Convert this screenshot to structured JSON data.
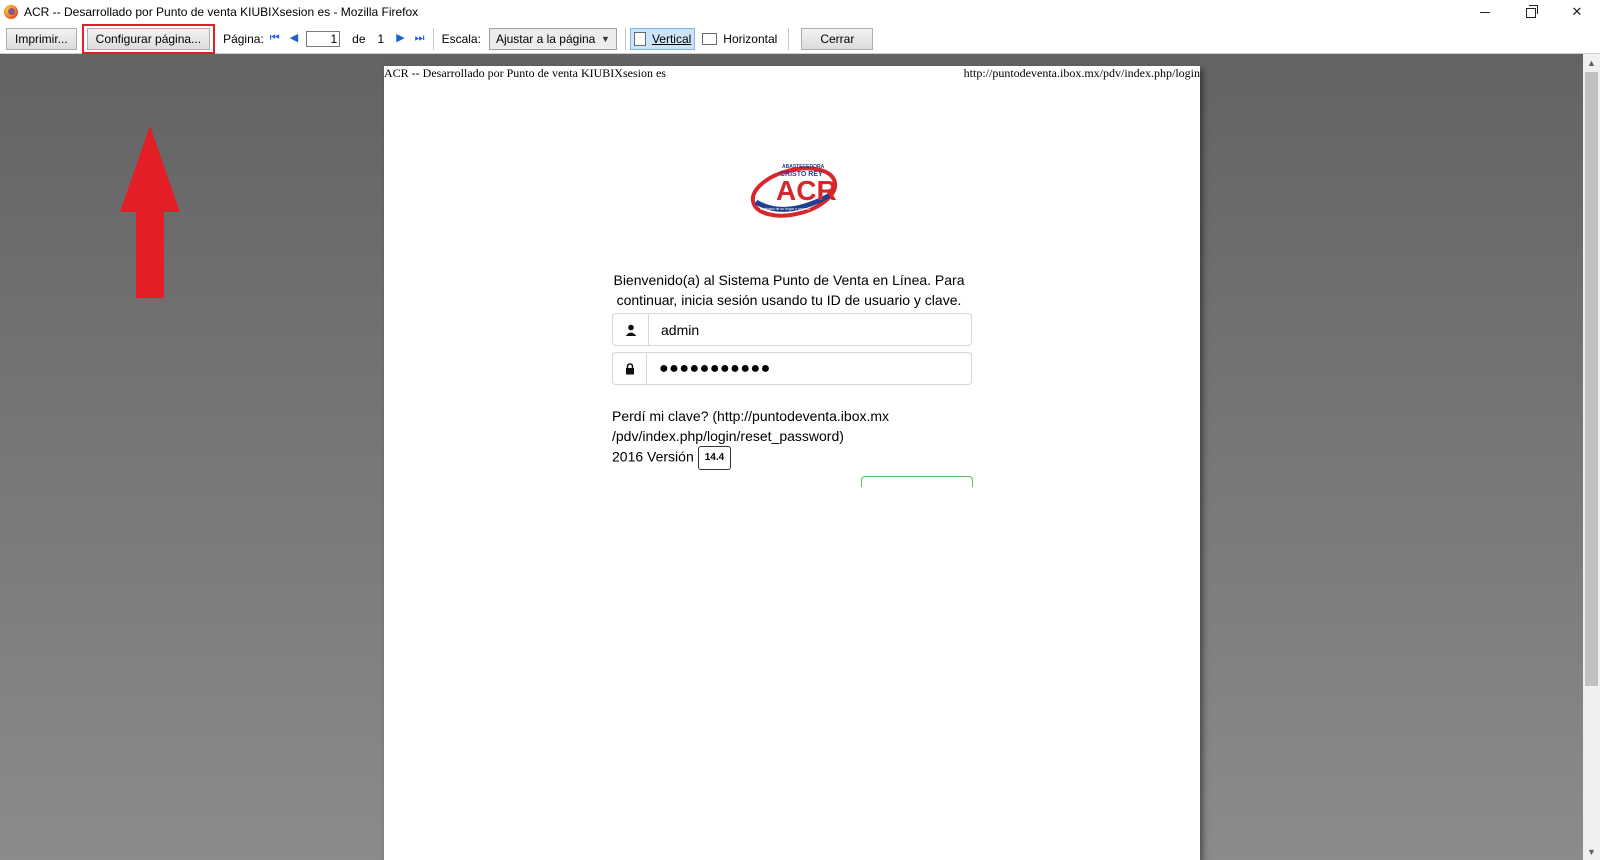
{
  "window": {
    "title": "ACR -- Desarrollado por Punto de venta KIUBIXsesion es - Mozilla Firefox",
    "minimize_glyph": "—",
    "close_glyph": "✕"
  },
  "toolbar": {
    "print_label": "Imprimir...",
    "page_setup_label": "Configurar página...",
    "page_label": "Página:",
    "page_current": "1",
    "of_label": "de",
    "page_total": "1",
    "first_glyph": "⏮",
    "prev_glyph": "◀",
    "next_glyph": "▶",
    "last_glyph": "⏭",
    "scale_label": "Escala:",
    "scale_value": "Ajustar a la página",
    "portrait_label": "Vertical",
    "landscape_label": "Horizontal",
    "close_label": "Cerrar"
  },
  "page": {
    "header_left": "ACR -- Desarrollado por Punto de venta KIUBIXsesion es",
    "header_right": "http://puntodeventa.ibox.mx/pdv/index.php/login",
    "logo_top_text": "ABASTECEDORA",
    "logo_name": "CRISTO REY",
    "logo_letters": "ACR",
    "logo_tagline": "El abasto de su hogar y negocio",
    "welcome_text": "Bienvenido(a) al Sistema Punto de Venta en Línea. Para continuar, inicia sesión usando tu ID de usuario y clave.",
    "username_value": "admin",
    "password_value": "●●●●●●●●●●●",
    "forgot_line1": "Perdí mi clave? (http://puntodeventa.ibox.mx",
    "forgot_line2": "/pdv/index.php/login/reset_password)",
    "version_prefix": "2016 Versión",
    "version_number": "14.4"
  },
  "colors": {
    "highlight": "#e41e26",
    "logo_red": "#d7262c",
    "logo_blue": "#1f3f8f",
    "nav_blue": "#1e5fd6"
  },
  "icons": {
    "username": "user-icon",
    "password": "lock-icon"
  }
}
